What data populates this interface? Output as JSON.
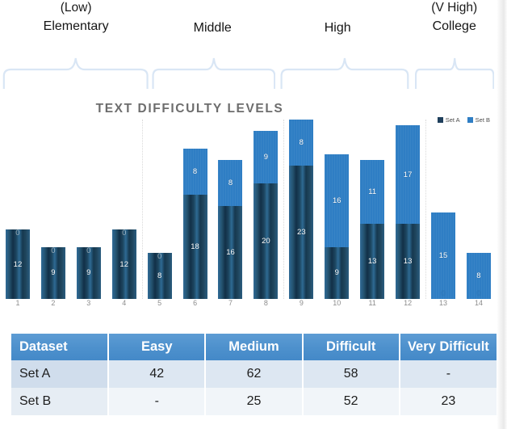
{
  "groups": [
    {
      "sub": "(Low)",
      "main": "Elementary",
      "center_pct": 15.3,
      "brace_left_pct": 0.5,
      "brace_width_pct": 29.5
    },
    {
      "sub": "",
      "main": "Middle",
      "center_pct": 42.8,
      "brace_left_pct": 30.5,
      "brace_width_pct": 25.0
    },
    {
      "sub": "",
      "main": "High",
      "center_pct": 68.0,
      "brace_left_pct": 56.5,
      "brace_width_pct": 26.0
    },
    {
      "sub": "(V High)",
      "main": "College",
      "center_pct": 91.5,
      "brace_left_pct": 83.5,
      "brace_width_pct": 16.0
    }
  ],
  "chart": {
    "title": "TEXT DIFFICULTY LEVELS",
    "legend": [
      {
        "label": "Set A",
        "color": "#1f3f5c"
      },
      {
        "label": "Set B",
        "color": "#2f7ec4"
      }
    ]
  },
  "chart_data": {
    "type": "bar",
    "stacked": true,
    "title": "TEXT DIFFICULTY LEVELS",
    "xlabel": "",
    "ylabel": "",
    "grid": false,
    "legend_position": "top-right",
    "ylim": [
      0,
      31
    ],
    "categories": [
      "1",
      "2",
      "3",
      "4",
      "5",
      "6",
      "7",
      "8",
      "9",
      "10",
      "11",
      "12",
      "13",
      "14"
    ],
    "series": [
      {
        "name": "Set A",
        "color": "#1f3f5c",
        "values": [
          12,
          9,
          9,
          12,
          8,
          18,
          16,
          20,
          23,
          9,
          13,
          13,
          0,
          0
        ]
      },
      {
        "name": "Set B",
        "color": "#2f7ec4",
        "values": [
          0,
          0,
          0,
          0,
          0,
          8,
          8,
          9,
          8,
          16,
          11,
          17,
          15,
          8
        ]
      }
    ],
    "group_brackets": [
      {
        "label": "Elementary",
        "qualifier": "(Low)",
        "categories": [
          "1",
          "2",
          "3",
          "4"
        ]
      },
      {
        "label": "Middle",
        "qualifier": "",
        "categories": [
          "5",
          "6",
          "7",
          "8"
        ]
      },
      {
        "label": "High",
        "qualifier": "",
        "categories": [
          "9",
          "10",
          "11",
          "12"
        ]
      },
      {
        "label": "College",
        "qualifier": "(V High)",
        "categories": [
          "13",
          "14"
        ]
      }
    ],
    "bar_segment_labels": [
      {
        "category": "1",
        "set_a": "12",
        "set_b": "0"
      },
      {
        "category": "2",
        "set_a": "9",
        "set_b": "0"
      },
      {
        "category": "3",
        "set_a": "9",
        "set_b": "0"
      },
      {
        "category": "4",
        "set_a": "12",
        "set_b": "0"
      },
      {
        "category": "5",
        "set_a": "8",
        "set_b": "0"
      },
      {
        "category": "6",
        "set_a": "18",
        "set_b": "8"
      },
      {
        "category": "7",
        "set_a": "16",
        "set_b": "8"
      },
      {
        "category": "8",
        "set_a": "20",
        "set_b": "9"
      },
      {
        "category": "9",
        "set_a": "23",
        "set_b": "8"
      },
      {
        "category": "10",
        "set_a": "9",
        "set_b": "16"
      },
      {
        "category": "11",
        "set_a": "13",
        "set_b": "11"
      },
      {
        "category": "12",
        "set_a": "13",
        "set_b": "17"
      },
      {
        "category": "13",
        "set_a": "0",
        "set_b": "15"
      },
      {
        "category": "14",
        "set_a": "0",
        "set_b": "8"
      }
    ]
  },
  "table": {
    "headers": [
      "Dataset",
      "Easy",
      "Medium",
      "Difficult",
      "Very Difficult"
    ],
    "rows": [
      {
        "dataset": "Set A",
        "easy": "42",
        "medium": "62",
        "difficult": "58",
        "very_difficult": "-"
      },
      {
        "dataset": "Set B",
        "easy": "-",
        "medium": "25",
        "difficult": "52",
        "very_difficult": "23"
      }
    ]
  }
}
